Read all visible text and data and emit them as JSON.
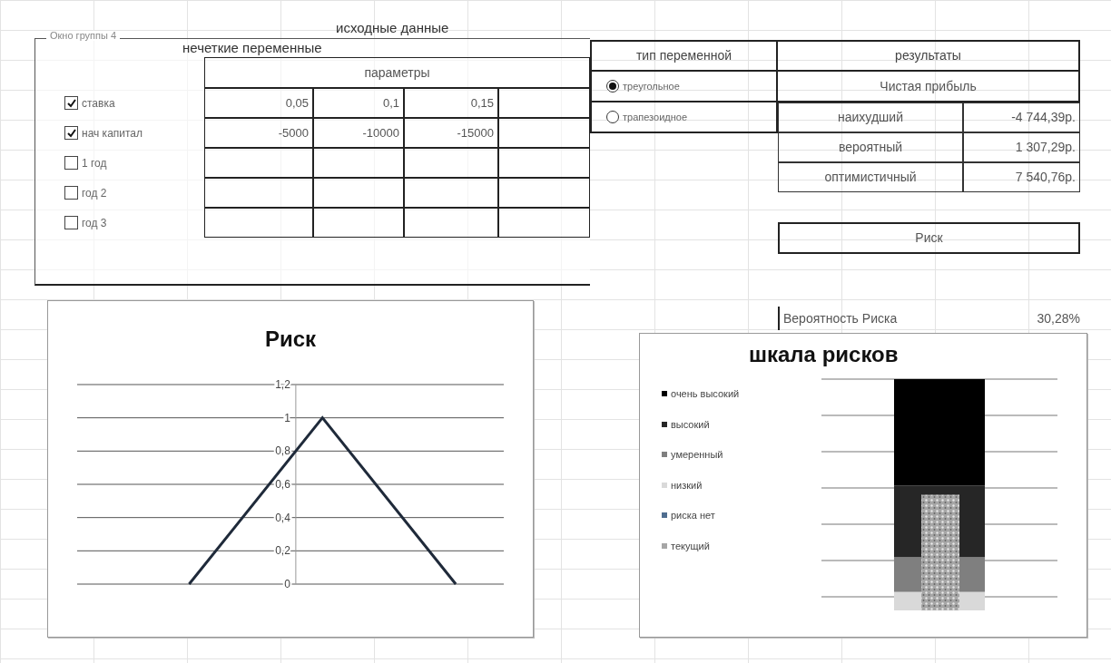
{
  "title": "исходные данные",
  "group_box": {
    "label": "Окно группы 4",
    "heading": "нечеткие переменные",
    "params_header": "параметры",
    "variables": [
      {
        "label": "ставка",
        "checked": true,
        "cells": [
          "0,05",
          "0,1",
          "0,15"
        ]
      },
      {
        "label": "нач капитал",
        "checked": true,
        "cells": [
          "-5000",
          "-10000",
          "-15000"
        ]
      },
      {
        "label": "1 год",
        "checked": false
      },
      {
        "label": "год 2",
        "checked": false
      },
      {
        "label": "год 3",
        "checked": false
      }
    ]
  },
  "variable_type": {
    "heading": "тип  переменной",
    "options": [
      {
        "label": "треугольное",
        "selected": true
      },
      {
        "label": "трапезоидное",
        "selected": false
      }
    ]
  },
  "results": {
    "heading": "результаты",
    "subheading": "Чистая прибыль",
    "rows": [
      {
        "label": "наихудший",
        "value": "-4 744,39р."
      },
      {
        "label": "вероятный",
        "value": "1 307,29р."
      },
      {
        "label": "оптимистичный",
        "value": "7 540,76р."
      }
    ],
    "risk_heading": "Риск",
    "probability": {
      "label": "Вероятность Риска",
      "value": "30,28%"
    }
  },
  "risk_chart": {
    "chart_data": {
      "type": "line",
      "title": "Риск",
      "grid": true,
      "ylim": [
        0,
        1.2
      ],
      "yticks": [
        0,
        {
          "value": 0.2,
          "label": "0,2"
        },
        {
          "value": 0.4,
          "label": "0,4"
        },
        {
          "value": 0.6,
          "label": "0,6"
        },
        {
          "value": 0.8,
          "label": "0,8"
        },
        1,
        {
          "value": 1.2,
          "label": "1,2"
        }
      ],
      "series": [
        {
          "color": "#1f2a3a",
          "values": [
            0,
            1,
            0
          ]
        }
      ]
    }
  },
  "risk_scale": {
    "title": "шкала рисков",
    "legend": [
      {
        "label": "очень высокий",
        "color": "#000000"
      },
      {
        "label": "высокий",
        "color": "#262626"
      },
      {
        "label": "умеренный",
        "color": "#7f7f7f"
      },
      {
        "label": "низкий",
        "color": "#d9d9d9"
      },
      {
        "label": "риска нет",
        "color": "#4f6d8f"
      },
      {
        "label": "текущий",
        "color": "#a6a6a6"
      }
    ]
  }
}
